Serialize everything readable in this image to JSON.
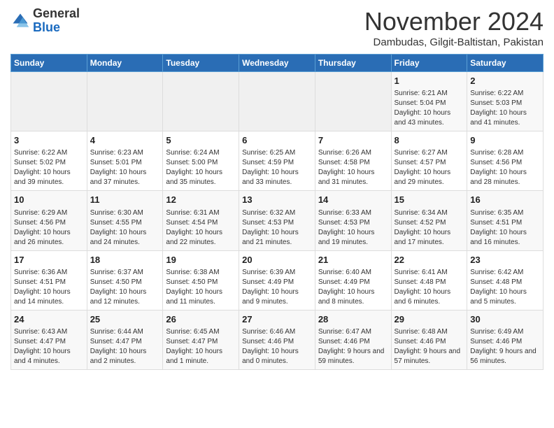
{
  "header": {
    "logo_general": "General",
    "logo_blue": "Blue",
    "month_title": "November 2024",
    "subtitle": "Dambudas, Gilgit-Baltistan, Pakistan"
  },
  "weekdays": [
    "Sunday",
    "Monday",
    "Tuesday",
    "Wednesday",
    "Thursday",
    "Friday",
    "Saturday"
  ],
  "weeks": [
    [
      {
        "day": "",
        "info": ""
      },
      {
        "day": "",
        "info": ""
      },
      {
        "day": "",
        "info": ""
      },
      {
        "day": "",
        "info": ""
      },
      {
        "day": "",
        "info": ""
      },
      {
        "day": "1",
        "info": "Sunrise: 6:21 AM\nSunset: 5:04 PM\nDaylight: 10 hours and 43 minutes."
      },
      {
        "day": "2",
        "info": "Sunrise: 6:22 AM\nSunset: 5:03 PM\nDaylight: 10 hours and 41 minutes."
      }
    ],
    [
      {
        "day": "3",
        "info": "Sunrise: 6:22 AM\nSunset: 5:02 PM\nDaylight: 10 hours and 39 minutes."
      },
      {
        "day": "4",
        "info": "Sunrise: 6:23 AM\nSunset: 5:01 PM\nDaylight: 10 hours and 37 minutes."
      },
      {
        "day": "5",
        "info": "Sunrise: 6:24 AM\nSunset: 5:00 PM\nDaylight: 10 hours and 35 minutes."
      },
      {
        "day": "6",
        "info": "Sunrise: 6:25 AM\nSunset: 4:59 PM\nDaylight: 10 hours and 33 minutes."
      },
      {
        "day": "7",
        "info": "Sunrise: 6:26 AM\nSunset: 4:58 PM\nDaylight: 10 hours and 31 minutes."
      },
      {
        "day": "8",
        "info": "Sunrise: 6:27 AM\nSunset: 4:57 PM\nDaylight: 10 hours and 29 minutes."
      },
      {
        "day": "9",
        "info": "Sunrise: 6:28 AM\nSunset: 4:56 PM\nDaylight: 10 hours and 28 minutes."
      }
    ],
    [
      {
        "day": "10",
        "info": "Sunrise: 6:29 AM\nSunset: 4:56 PM\nDaylight: 10 hours and 26 minutes."
      },
      {
        "day": "11",
        "info": "Sunrise: 6:30 AM\nSunset: 4:55 PM\nDaylight: 10 hours and 24 minutes."
      },
      {
        "day": "12",
        "info": "Sunrise: 6:31 AM\nSunset: 4:54 PM\nDaylight: 10 hours and 22 minutes."
      },
      {
        "day": "13",
        "info": "Sunrise: 6:32 AM\nSunset: 4:53 PM\nDaylight: 10 hours and 21 minutes."
      },
      {
        "day": "14",
        "info": "Sunrise: 6:33 AM\nSunset: 4:53 PM\nDaylight: 10 hours and 19 minutes."
      },
      {
        "day": "15",
        "info": "Sunrise: 6:34 AM\nSunset: 4:52 PM\nDaylight: 10 hours and 17 minutes."
      },
      {
        "day": "16",
        "info": "Sunrise: 6:35 AM\nSunset: 4:51 PM\nDaylight: 10 hours and 16 minutes."
      }
    ],
    [
      {
        "day": "17",
        "info": "Sunrise: 6:36 AM\nSunset: 4:51 PM\nDaylight: 10 hours and 14 minutes."
      },
      {
        "day": "18",
        "info": "Sunrise: 6:37 AM\nSunset: 4:50 PM\nDaylight: 10 hours and 12 minutes."
      },
      {
        "day": "19",
        "info": "Sunrise: 6:38 AM\nSunset: 4:50 PM\nDaylight: 10 hours and 11 minutes."
      },
      {
        "day": "20",
        "info": "Sunrise: 6:39 AM\nSunset: 4:49 PM\nDaylight: 10 hours and 9 minutes."
      },
      {
        "day": "21",
        "info": "Sunrise: 6:40 AM\nSunset: 4:49 PM\nDaylight: 10 hours and 8 minutes."
      },
      {
        "day": "22",
        "info": "Sunrise: 6:41 AM\nSunset: 4:48 PM\nDaylight: 10 hours and 6 minutes."
      },
      {
        "day": "23",
        "info": "Sunrise: 6:42 AM\nSunset: 4:48 PM\nDaylight: 10 hours and 5 minutes."
      }
    ],
    [
      {
        "day": "24",
        "info": "Sunrise: 6:43 AM\nSunset: 4:47 PM\nDaylight: 10 hours and 4 minutes."
      },
      {
        "day": "25",
        "info": "Sunrise: 6:44 AM\nSunset: 4:47 PM\nDaylight: 10 hours and 2 minutes."
      },
      {
        "day": "26",
        "info": "Sunrise: 6:45 AM\nSunset: 4:47 PM\nDaylight: 10 hours and 1 minute."
      },
      {
        "day": "27",
        "info": "Sunrise: 6:46 AM\nSunset: 4:46 PM\nDaylight: 10 hours and 0 minutes."
      },
      {
        "day": "28",
        "info": "Sunrise: 6:47 AM\nSunset: 4:46 PM\nDaylight: 9 hours and 59 minutes."
      },
      {
        "day": "29",
        "info": "Sunrise: 6:48 AM\nSunset: 4:46 PM\nDaylight: 9 hours and 57 minutes."
      },
      {
        "day": "30",
        "info": "Sunrise: 6:49 AM\nSunset: 4:46 PM\nDaylight: 9 hours and 56 minutes."
      }
    ]
  ]
}
